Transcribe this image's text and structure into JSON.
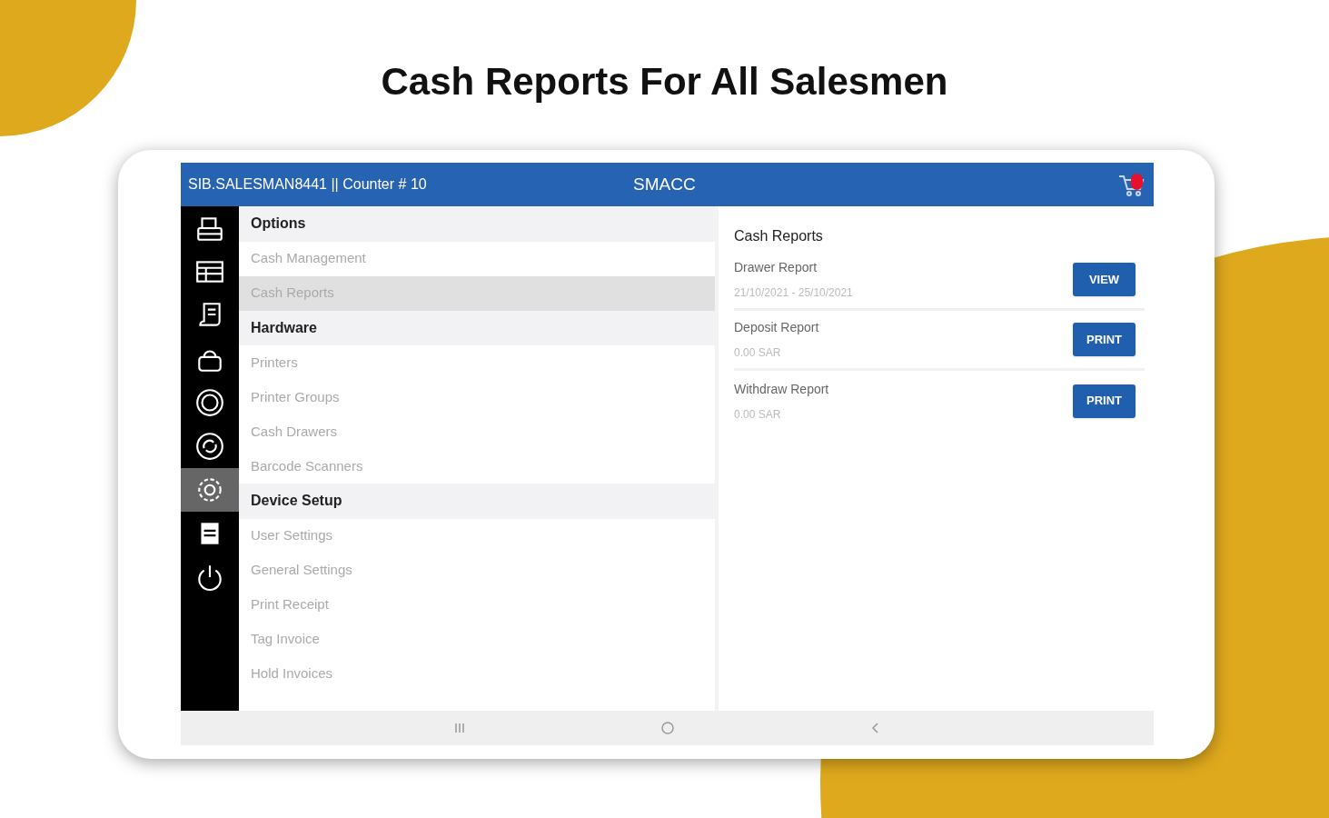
{
  "headline": "Cash Reports For All Salesmen",
  "header": {
    "user": "SIB.SALESMAN8441 || Counter  # 10",
    "app_title": "SMACC"
  },
  "sidebar": {
    "items": [
      {
        "kind": "register",
        "selected": false
      },
      {
        "kind": "invoice",
        "selected": false
      },
      {
        "kind": "receipt",
        "selected": false
      },
      {
        "kind": "bag",
        "selected": false
      },
      {
        "kind": "ring",
        "selected": false
      },
      {
        "kind": "sync",
        "selected": false
      },
      {
        "kind": "settings",
        "selected": true
      },
      {
        "kind": "document",
        "selected": false
      },
      {
        "kind": "power",
        "selected": false
      }
    ]
  },
  "menu": [
    {
      "kind": "header",
      "label": "Options"
    },
    {
      "kind": "item",
      "label": "Cash Management",
      "selected": false
    },
    {
      "kind": "item",
      "label": "Cash Reports",
      "selected": true
    },
    {
      "kind": "header",
      "label": "Hardware"
    },
    {
      "kind": "item",
      "label": "Printers",
      "selected": false
    },
    {
      "kind": "item",
      "label": "Printer Groups",
      "selected": false
    },
    {
      "kind": "item",
      "label": "Cash Drawers",
      "selected": false
    },
    {
      "kind": "item",
      "label": "Barcode Scanners",
      "selected": false
    },
    {
      "kind": "header",
      "label": "Device Setup"
    },
    {
      "kind": "item",
      "label": "User Settings",
      "selected": false
    },
    {
      "kind": "item",
      "label": "General Settings",
      "selected": false
    },
    {
      "kind": "item",
      "label": "Print Receipt",
      "selected": false
    },
    {
      "kind": "item",
      "label": "Tag Invoice",
      "selected": false
    },
    {
      "kind": "item",
      "label": "Hold Invoices",
      "selected": false
    }
  ],
  "reports": {
    "title": "Cash Reports",
    "rows": [
      {
        "name": "Drawer Report",
        "detail": "21/10/2021 - 25/10/2021",
        "button": "VIEW"
      },
      {
        "name": "Deposit Report",
        "detail": "0.00 SAR",
        "button": "PRINT"
      },
      {
        "name": "Withdraw Report",
        "detail": "0.00 SAR",
        "button": "PRINT"
      }
    ]
  }
}
